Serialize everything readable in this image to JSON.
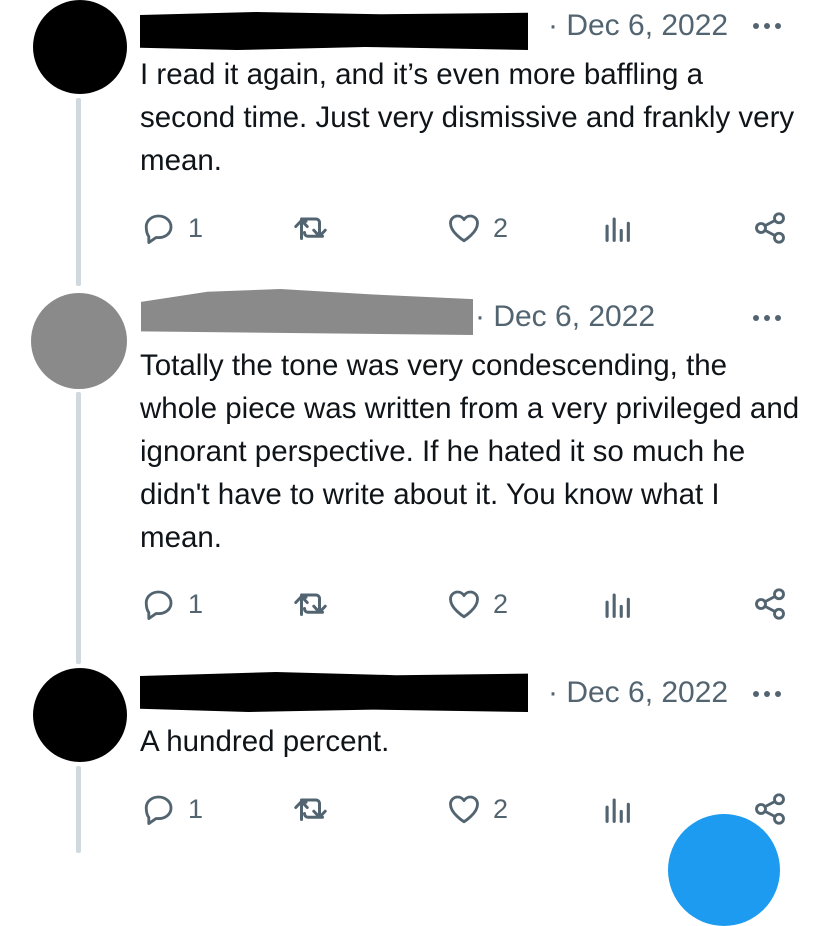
{
  "tweets": [
    {
      "date": "· Dec 6, 2022",
      "text": "I read it again, and it’s even more baffling a second time. Just very dismissive and frankly very mean.",
      "avatar_color": "#000000",
      "redaction_color": "#000000",
      "stats": {
        "replies": "1",
        "likes": "2"
      }
    },
    {
      "date": "· Dec 6, 2022",
      "text": "Totally the tone was  very condescending, the whole piece was written from a very privileged and ignorant perspective. If he hated it so much he didn't have to write about it. You know what I mean.",
      "avatar_color": "#8a8a8a",
      "redaction_color": "#8a8a8a",
      "stats": {
        "replies": "1",
        "likes": "2"
      }
    },
    {
      "date": "· Dec 6, 2022",
      "text": "A hundred percent.",
      "avatar_color": "#000000",
      "redaction_color": "#000000",
      "stats": {
        "replies": "1",
        "likes": "2"
      }
    }
  ],
  "icons": {
    "reply": "reply-icon",
    "retweet": "retweet-icon",
    "like": "like-icon",
    "views": "views-icon",
    "share": "share-icon",
    "more": "more-icon"
  },
  "colors": {
    "text": "#0f1419",
    "secondary": "#536471",
    "thread_line": "#cfd9de",
    "accent": "#1d9bf0"
  }
}
